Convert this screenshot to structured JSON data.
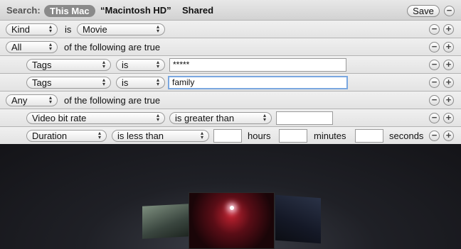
{
  "search": {
    "label": "Search:",
    "scopes": [
      "This Mac",
      "“Macintosh HD”",
      "Shared"
    ],
    "save_label": "Save"
  },
  "rules": [
    {
      "attribute": "Kind",
      "operator_text": "is",
      "value_select": "Movie"
    },
    {
      "group_mode": "All",
      "group_text": "of the following are true"
    },
    {
      "attribute": "Tags",
      "operator": "is",
      "value": "*****"
    },
    {
      "attribute": "Tags",
      "operator": "is",
      "value": "family"
    },
    {
      "group_mode": "Any",
      "group_text": "of the following are true"
    },
    {
      "attribute": "Video bit rate",
      "operator": "is greater than",
      "value": ""
    },
    {
      "attribute": "Duration",
      "operator": "is less than",
      "value1": "",
      "unit1": "hours",
      "value2": "",
      "unit2": "minutes",
      "value3": "",
      "unit3": "seconds"
    }
  ],
  "icons": {
    "remove": "minus-circle-icon",
    "add": "plus-circle-icon",
    "popup": "updown-arrows-icon"
  },
  "colors": {
    "scope_selected": "#8a8a8a",
    "focus_ring": "#7aa7e0",
    "preview_bg": "#1c1d22"
  }
}
